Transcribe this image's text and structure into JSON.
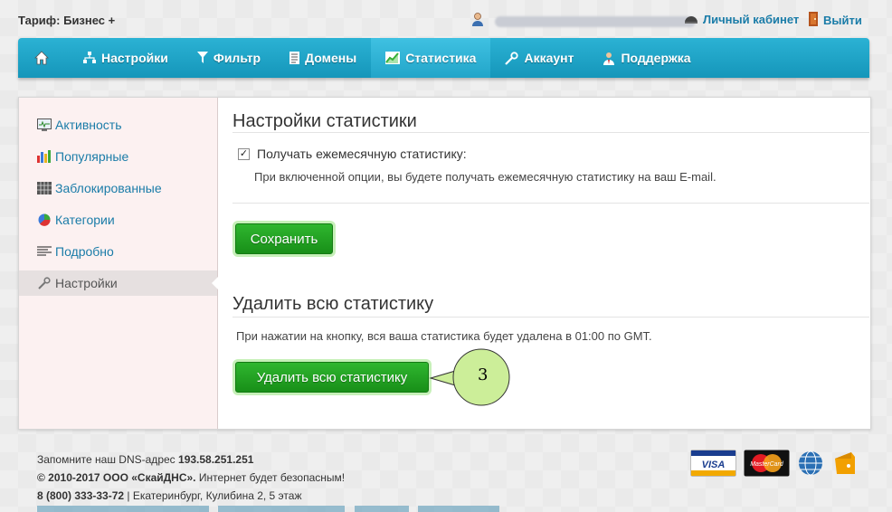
{
  "header": {
    "tariff": "Тариф: Бизнес +",
    "cabinet_label": "Личный кабинет",
    "logout_label": "Выйти"
  },
  "nav": {
    "items": [
      {
        "label": "",
        "icon": "home-icon"
      },
      {
        "label": "Настройки",
        "icon": "sitemap-icon"
      },
      {
        "label": "Фильтр",
        "icon": "funnel-icon"
      },
      {
        "label": "Домены",
        "icon": "document-icon"
      },
      {
        "label": "Статистика",
        "icon": "chart-icon",
        "active": true
      },
      {
        "label": "Аккаунт",
        "icon": "wrench-icon"
      },
      {
        "label": "Поддержка",
        "icon": "support-person-icon"
      }
    ]
  },
  "sidebar": {
    "items": [
      {
        "label": "Активность",
        "icon": "activity-monitor-icon"
      },
      {
        "label": "Популярные",
        "icon": "bar-chart-icon"
      },
      {
        "label": "Заблокированные",
        "icon": "grid-block-icon"
      },
      {
        "label": "Категории",
        "icon": "pie-chart-icon"
      },
      {
        "label": "Подробно",
        "icon": "list-lines-icon"
      },
      {
        "label": "Настройки",
        "icon": "wrench-icon",
        "active": true
      }
    ]
  },
  "settings": {
    "title": "Настройки статистики",
    "checkbox_label": "Получать ежемесячную статистику:",
    "checkbox_checked": true,
    "hint": "При включенной опции, вы будете получать ежемесячную статистику на ваш E-mail.",
    "save_label": "Сохранить"
  },
  "delete": {
    "title": "Удалить всю статистику",
    "hint": "При нажатии на кнопку, вся ваша статистика будет удалена в 01:00 по GMT.",
    "button_label": "Удалить всю статистику"
  },
  "callout": {
    "number": "3"
  },
  "footer": {
    "dns_text": "Запомните наш DNS-адрес",
    "dns_ip": "193.58.251.251",
    "copyright_bold": "© 2010-2017 ООО «СкайДНС».",
    "copyright_rest": "Интернет будет безопасным!",
    "phone": "8 (800) 333-33-72",
    "address": "| Екатеринбург, Кулибина 2, 5 этаж"
  },
  "payments": {
    "visa": "VISA",
    "mastercard": "MasterCard"
  },
  "colors": {
    "nav": "#1ea6c9",
    "link": "#1a7ca8",
    "button_green": "#22a322",
    "callout": "#ccee99"
  }
}
